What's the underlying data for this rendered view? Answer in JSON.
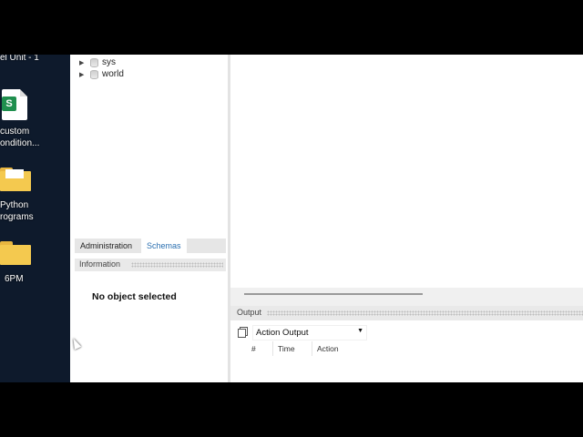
{
  "desktop": {
    "top_label": "el Unit - 1",
    "items": [
      {
        "icon": "spreadsheet-icon",
        "line1": "custom",
        "line2": "ondition..."
      },
      {
        "icon": "folder-icon",
        "line1": "Python",
        "line2": "rograms"
      },
      {
        "icon": "folder-icon",
        "line1": "6PM"
      }
    ]
  },
  "navigator": {
    "schemas": [
      "sys",
      "world"
    ],
    "tabs": [
      "Administration",
      "Schemas"
    ],
    "active_tab": "Schemas",
    "info_label": "Information",
    "no_selection": "No object selected"
  },
  "output": {
    "title": "Output",
    "dropdown_value": "Action Output",
    "columns": [
      "#",
      "Time",
      "Action"
    ]
  },
  "colors": {
    "desktop_bg": "#0e1a2c",
    "active_tab_text": "#2a6fb0",
    "spreadsheet_green": "#1f8f4e",
    "folder_yellow": "#f4c94f"
  }
}
